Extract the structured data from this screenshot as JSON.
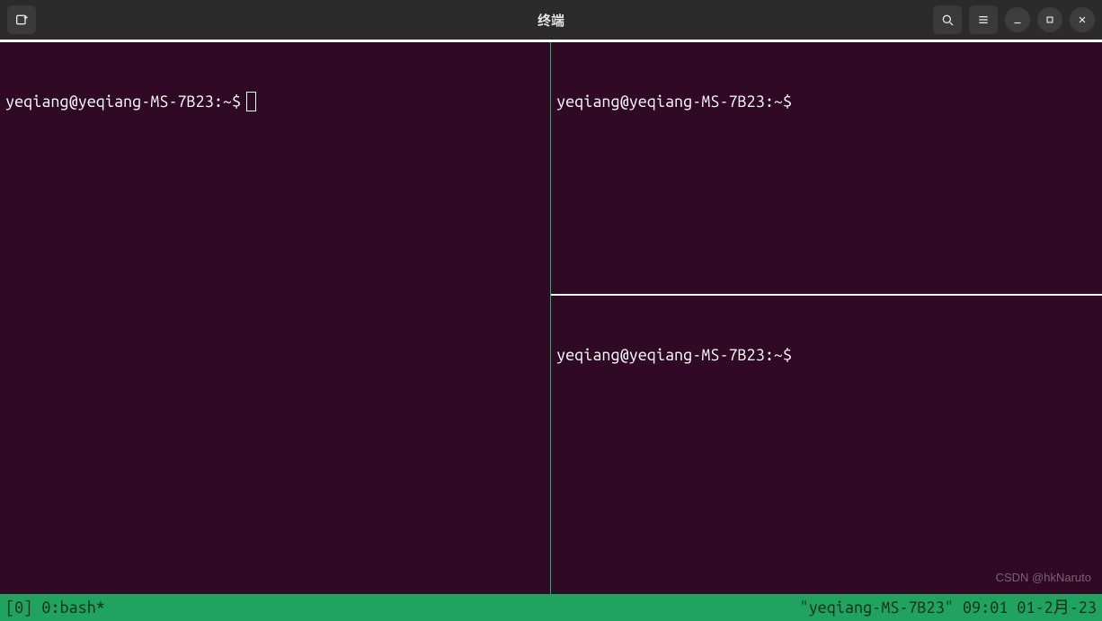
{
  "window": {
    "title": "终端"
  },
  "panes": {
    "left": {
      "prompt": "yeqiang@yeqiang-MS-7B23:~$"
    },
    "top_right": {
      "prompt": "yeqiang@yeqiang-MS-7B23:~$"
    },
    "bottom_right": {
      "prompt": "yeqiang@yeqiang-MS-7B23:~$"
    }
  },
  "status": {
    "left": "[0] 0:bash*",
    "right": "\"yeqiang-MS-7B23\" 09:01 01-2月-23"
  },
  "watermark": "CSDN @hkNaruto"
}
